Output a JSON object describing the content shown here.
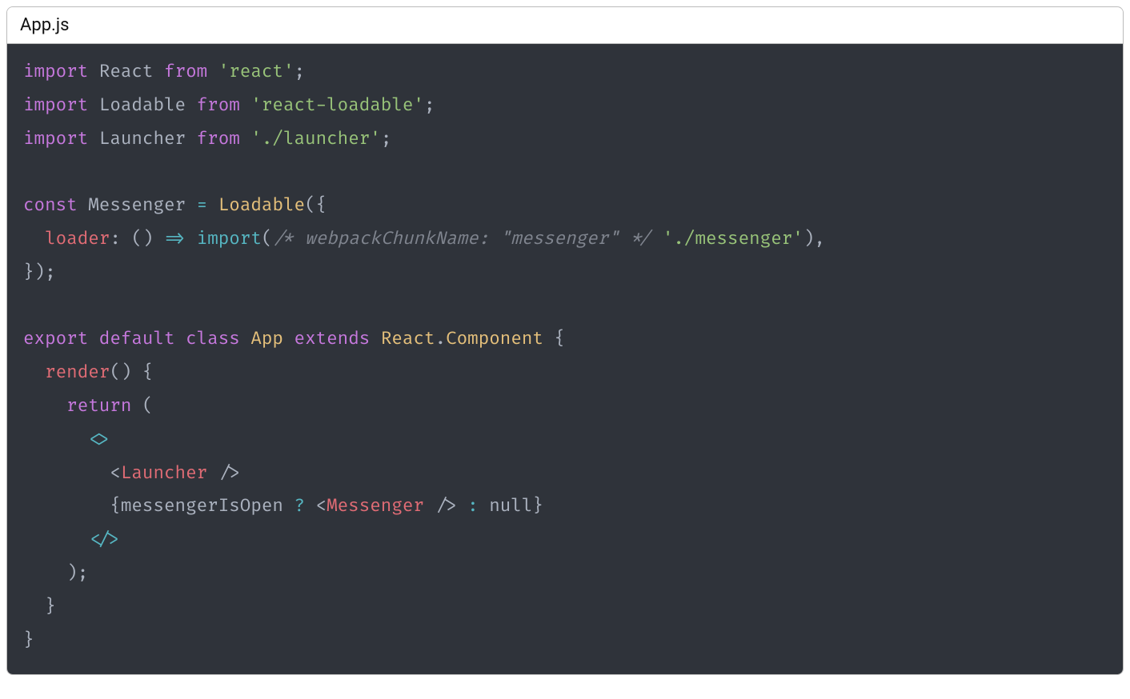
{
  "filename": "App.js",
  "code": {
    "l1": {
      "kw_import": "import",
      "ident": "React",
      "kw_from": "from",
      "str": "'react'",
      "semi": ";"
    },
    "l2": {
      "kw_import": "import",
      "ident": "Loadable",
      "kw_from": "from",
      "str": "'react-loadable'",
      "semi": ";"
    },
    "l3": {
      "kw_import": "import",
      "ident": "Launcher",
      "kw_from": "from",
      "str": "'./launcher'",
      "semi": ";"
    },
    "l5": {
      "kw_const": "const",
      "ident": "Messenger",
      "eq": "=",
      "call": "Loadable",
      "open": "({"
    },
    "l6": {
      "indent": "  ",
      "prop": "loader",
      "colon": ":",
      "parens": "()",
      "arrow": "=>",
      "importfn": "import",
      "open": "(",
      "comment": "/* webpackChunkName: \"messenger\" */",
      "str": "'./messenger'",
      "close": "),"
    },
    "l7": {
      "close": "});"
    },
    "l9": {
      "kw_export": "export",
      "kw_default": "default",
      "kw_class": "class",
      "name": "App",
      "kw_extends": "extends",
      "react": "React",
      "dot": ".",
      "component": "Component",
      "brace": " {"
    },
    "l10": {
      "indent": "  ",
      "fn": "render",
      "parens": "()",
      "brace": " {"
    },
    "l11": {
      "indent": "    ",
      "kw_return": "return",
      "open": " ("
    },
    "l12": {
      "indent": "      ",
      "frag_open_l": "<",
      "frag_open_r": ">"
    },
    "l13": {
      "indent": "        ",
      "lt": "<",
      "tag": "Launcher",
      "slashgt": " />"
    },
    "l14": {
      "indent": "        ",
      "lb": "{",
      "ident": "messengerIsOpen",
      "q": " ? ",
      "lt": "<",
      "tag": "Messenger",
      "slashgt": " />",
      "colon": " : ",
      "null": "null",
      "rb": "}"
    },
    "l15": {
      "indent": "      ",
      "frag_close_l": "<",
      "frag_close_slash": "/",
      "frag_close_r": ">"
    },
    "l16": {
      "indent": "    ",
      "close": ");"
    },
    "l17": {
      "indent": "  ",
      "brace": "}"
    },
    "l18": {
      "brace": "}"
    }
  }
}
